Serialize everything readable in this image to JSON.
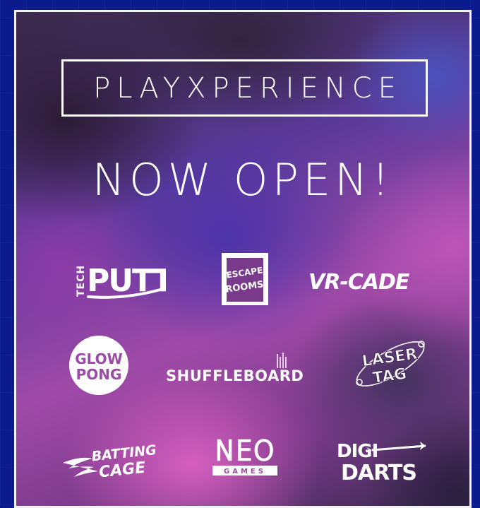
{
  "brand": {
    "name": "PLAYXPERIENCE"
  },
  "headline": {
    "text": "NOW OPEN!"
  },
  "attractions": {
    "tech_putt": {
      "small": "TECH",
      "big": "PUTT"
    },
    "escape_rooms": {
      "line1": "ESCAPE",
      "line2": "ROOMS"
    },
    "vr_cade": {
      "text": "VR-CADE"
    },
    "glow_pong": {
      "line1": "GLOW",
      "line2": "PONG"
    },
    "shuffleboard": {
      "text": "SHUFFLEBOARD"
    },
    "laser_tag": {
      "line1": "LASER",
      "line2": "TAG"
    },
    "batting_cage": {
      "line1": "BATTING",
      "line2": "CAGE"
    },
    "neo_games": {
      "big": "NEO",
      "small": "GAMES"
    },
    "digi_darts": {
      "line1": "DIGI",
      "line2": "DARTS"
    }
  },
  "colors": {
    "outer_background": "#0b1a8c",
    "border": "#f2f2f2",
    "text": "#ffffff",
    "glow_pong_text": "#9b4aa6"
  }
}
